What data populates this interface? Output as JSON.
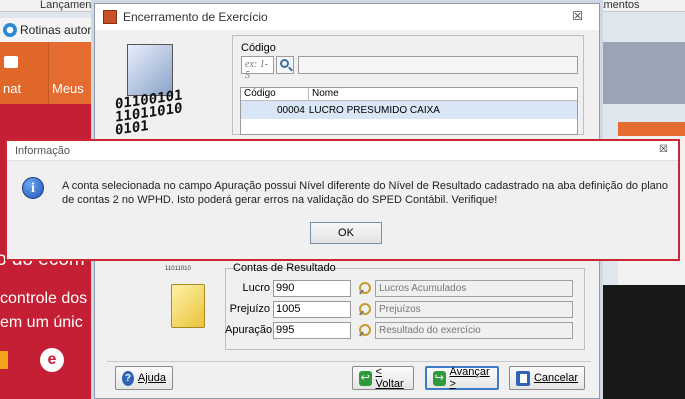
{
  "background": {
    "tabs": [
      "Lançamento",
      "rramentos"
    ],
    "rotinas_label": "Rotinas automáti",
    "tile_chat": "nat",
    "tile_meus": "Meus",
    "banner_big": "o do ecom",
    "banner_line1": "controle dos",
    "banner_line2": "em um únic"
  },
  "dialog": {
    "title": "Encerramento de Exercício",
    "close": "☒",
    "art_binary": [
      "01100101",
      "11011010",
      "0101"
    ],
    "codigo": {
      "label": "Código",
      "placeholder": "ex: 1-5",
      "value": ""
    },
    "grid": {
      "headers": [
        "Código",
        "Nome"
      ],
      "rows": [
        {
          "codigo": "00004",
          "nome": "LUCRO PRESUMIDO CAIXA"
        }
      ]
    },
    "folder_bits": "11011010",
    "contas": {
      "label": "Contas de Resultado",
      "fields": [
        {
          "label": "Lucro",
          "value": "990",
          "description": "Lucros Acumulados"
        },
        {
          "label": "Prejuízo",
          "value": "1005",
          "description": "Prejuízos"
        },
        {
          "label": "Apuração",
          "value": "995",
          "description": "Resultado do exercício"
        }
      ]
    },
    "buttons": {
      "ajuda": "Ajuda",
      "voltar": "< Voltar",
      "avancar": "Avançar >",
      "cancelar": "Cancelar"
    }
  },
  "message_box": {
    "title": "Informação",
    "close": "☒",
    "icon": "i",
    "text": "A conta selecionada no campo Apuração possui Nível diferente do Nível de Resultado cadastrado na aba definição do plano de contas 2 no WPHD. Isto poderá gerar erros na validação do SPED Contábil. Verifique!",
    "ok_label": "OK"
  },
  "colors": {
    "highlight_border": "#cc2633",
    "brand_orange": "#e0672a",
    "brand_red": "#c41f34"
  }
}
